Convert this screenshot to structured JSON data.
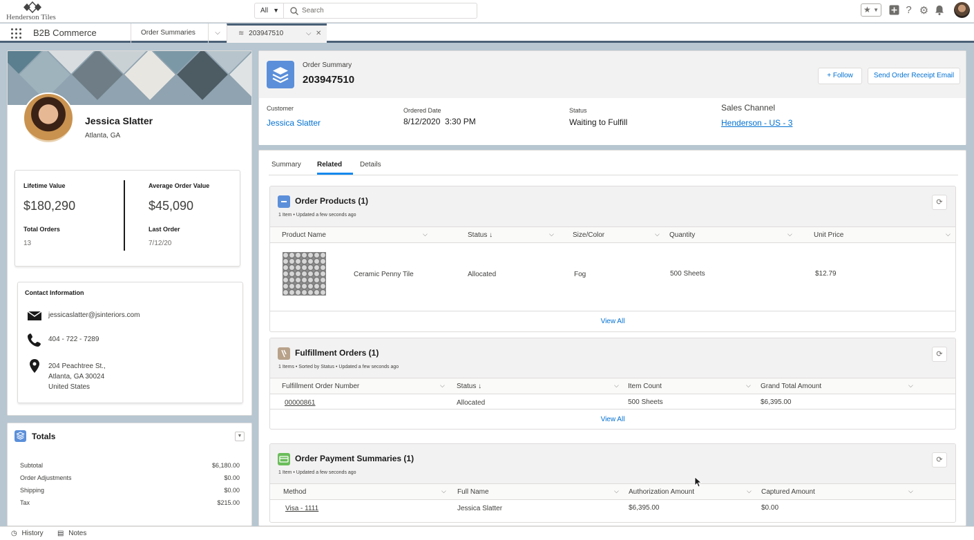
{
  "header": {
    "logo_text": "Henderson Tiles",
    "search_scope": "All",
    "search_placeholder": "Search"
  },
  "nav": {
    "app_name": "B2B Commerce",
    "tabs": [
      {
        "label": "Order Summaries"
      },
      {
        "label": "203947510"
      }
    ]
  },
  "profile": {
    "name": "Jessica Slatter",
    "location": "Atlanta, GA",
    "stats": {
      "lifetime_value_label": "Lifetime Value",
      "lifetime_value": "$180,290",
      "avg_order_label": "Average Order Value",
      "avg_order": "$45,090",
      "total_orders_label": "Total Orders",
      "total_orders": "13",
      "last_order_label": "Last Order",
      "last_order": "7/12/20"
    },
    "contact": {
      "title": "Contact Information",
      "email": "jessicaslatter@jsinteriors.com",
      "phone": "404 - 722 - 7289",
      "address_line1": "204 Peachtree St.,",
      "address_line2": "Atlanta, GA 30024",
      "address_line3": "United States"
    }
  },
  "totals": {
    "title": "Totals",
    "rows": [
      {
        "label": "Subtotal",
        "value": "$6,180.00"
      },
      {
        "label": "Order Adjustments",
        "value": "$0.00"
      },
      {
        "label": "Shipping",
        "value": "$0.00"
      },
      {
        "label": "Tax",
        "value": "$215.00"
      }
    ]
  },
  "utility": {
    "history": "History",
    "notes": "Notes"
  },
  "record": {
    "type": "Order Summary",
    "number": "203947510",
    "follow_label": "+ Follow",
    "send_receipt_label": "Send Order Receipt Email",
    "customer_label": "Customer",
    "customer": "Jessica Slatter",
    "ordered_date_label": "Ordered Date",
    "ordered_date": "8/12/2020  3:30 PM",
    "status_label": "Status",
    "status": "Waiting to Fulfill",
    "sales_channel_label": "Sales Channel",
    "sales_channel": "Henderson - US - 3"
  },
  "tabs": [
    "Summary",
    "Related",
    "Details"
  ],
  "order_products": {
    "title": "Order Products (1)",
    "subtitle": "1 Item • Updated a few seconds ago",
    "columns": [
      "Product Name",
      "Status ↓",
      "Size/Color",
      "Quantity",
      "Unit Price"
    ],
    "rows": [
      {
        "product": "Ceramic Penny Tile",
        "status": "Allocated",
        "size_color": "Fog",
        "quantity": "500 Sheets",
        "unit_price": "$12.79"
      }
    ],
    "view_all": "View All"
  },
  "fulfillment_orders": {
    "title": "Fulfillment Orders (1)",
    "subtitle": "1 Items • Sorted by Status • Updated a few seconds ago",
    "columns": [
      "Fulfillment Order Number",
      "Status ↓",
      "Item Count",
      "Grand Total Amount"
    ],
    "rows": [
      {
        "number": "00000861",
        "status": "Allocated",
        "item_count": "500 Sheets",
        "grand_total": "$6,395.00"
      }
    ],
    "view_all": "View All"
  },
  "payment_summaries": {
    "title": "Order Payment Summaries (1)",
    "subtitle": "1 Item • Updated a few seconds ago",
    "columns": [
      "Method",
      "Full Name",
      "Authorization Amount",
      "Captured Amount"
    ],
    "rows": [
      {
        "method": "Visa - 1111",
        "full_name": "Jessica Slatter",
        "auth_amount": "$6,395.00",
        "captured": "$0.00"
      }
    ]
  },
  "colors": {
    "brand_blue": "#0070d2",
    "order_icon": "#5b8fd9",
    "fulfillment_icon": "#b8a28a",
    "payment_icon": "#6bbd5b",
    "nav_accent": "#4a6076"
  }
}
